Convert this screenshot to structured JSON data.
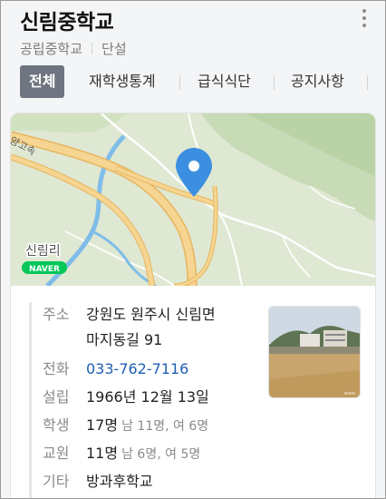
{
  "header": {
    "title": "신림중학교",
    "subtitle_type": "공립중학교",
    "subtitle_gender": "단설"
  },
  "tabs": [
    {
      "label": "전체",
      "active": true
    },
    {
      "label": "재학생통계",
      "active": false
    },
    {
      "label": "급식식단",
      "active": false
    },
    {
      "label": "공지사항",
      "active": false
    }
  ],
  "map": {
    "road_label": "양고속",
    "place_label": "신림리",
    "brand_badge": "NAVER",
    "pin_color": "#3c8fe0",
    "road_color": "#f2cf84",
    "river_color": "#7fbde8"
  },
  "info": {
    "address_label": "주소",
    "address_line1": "강원도 원주시 신림면",
    "address_line2": "마지동길 91",
    "phone_label": "전화",
    "phone_value": "033-762-7116",
    "founded_label": "설립",
    "founded_value": "1966년 12월 13일",
    "students_label": "학생",
    "students_total": "17명",
    "students_detail": "남 11명, 여 6명",
    "staff_label": "교원",
    "staff_total": "11명",
    "staff_detail": "남 6명, 여 5명",
    "etc_label": "기타",
    "etc_value": "방과후학교"
  }
}
